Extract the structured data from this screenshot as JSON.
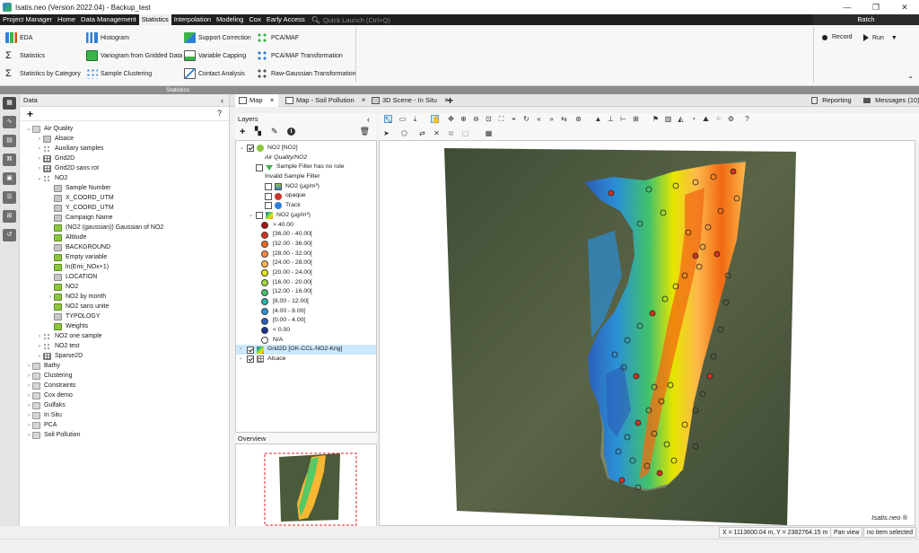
{
  "window": {
    "title": "Isatis.neo (Version 2022.04) - Backup_test",
    "controls": [
      "—",
      "❐",
      "✕"
    ]
  },
  "menu": {
    "items": [
      "Project Manager",
      "Home",
      "Data Management",
      "Statistics",
      "Interpolation",
      "Modeling",
      "Cox",
      "Early Access"
    ],
    "active": "Statistics",
    "quick_launch": "Quick Launch (Ctrl+Q)",
    "batch": "Batch"
  },
  "ribbon": {
    "col1": [
      "EDA",
      "Statistics",
      "Statistics by Category"
    ],
    "col2": [
      "Histogram",
      "Variogram from Gridded Data",
      "Sample Clustering"
    ],
    "col3": [
      "Support Correction",
      "Variable Capping",
      "Contact Analysis"
    ],
    "col4": [
      "PCA/MAF",
      "PCA/MAF Transformation",
      "Raw-Gaussian Transformation"
    ],
    "group_label": "Statistics",
    "batch_record": "Record",
    "batch_run": "Run"
  },
  "data_panel": {
    "title": "Data",
    "add": "+",
    "help": "?",
    "tree": [
      {
        "label": "Air Quality",
        "indent": 0,
        "icon": "folder",
        "caret": "⌄"
      },
      {
        "label": "Alsace",
        "indent": 1,
        "icon": "polygon",
        "caret": "›"
      },
      {
        "label": "Auxiliary samples",
        "indent": 1,
        "icon": "points",
        "caret": "›"
      },
      {
        "label": "Grid2D",
        "indent": 1,
        "icon": "grid",
        "caret": "›"
      },
      {
        "label": "Grid2D sans rot",
        "indent": 1,
        "icon": "grid",
        "caret": "›"
      },
      {
        "label": "NO2",
        "indent": 1,
        "icon": "points",
        "caret": "⌄"
      },
      {
        "label": "Sample Number",
        "indent": 2,
        "icon": "var",
        "caret": ""
      },
      {
        "label": "X_COORD_UTM",
        "indent": 2,
        "icon": "var",
        "caret": ""
      },
      {
        "label": "Y_COORD_UTM",
        "indent": 2,
        "icon": "var",
        "caret": ""
      },
      {
        "label": "Campaign Name",
        "indent": 2,
        "icon": "var",
        "caret": ""
      },
      {
        "label": "(NO2 (gaussian)) Gaussian of NO2",
        "indent": 2,
        "icon": "var-g",
        "caret": ""
      },
      {
        "label": "Altitude",
        "indent": 2,
        "icon": "var-g",
        "caret": ""
      },
      {
        "label": "BACKGROUND",
        "indent": 2,
        "icon": "var",
        "caret": ""
      },
      {
        "label": "Empty variable",
        "indent": 2,
        "icon": "var-g",
        "caret": ""
      },
      {
        "label": "ln(Emi_NOx+1)",
        "indent": 2,
        "icon": "var-g",
        "caret": ""
      },
      {
        "label": "LOCATION",
        "indent": 2,
        "icon": "var",
        "caret": ""
      },
      {
        "label": "NO2",
        "indent": 2,
        "icon": "var-g",
        "caret": ""
      },
      {
        "label": "NO2 by month",
        "indent": 2,
        "icon": "var-g",
        "caret": "›"
      },
      {
        "label": "NO2 sans unite",
        "indent": 2,
        "icon": "var-g",
        "caret": ""
      },
      {
        "label": "TYPOLOGY",
        "indent": 2,
        "icon": "var",
        "caret": ""
      },
      {
        "label": "Weights",
        "indent": 2,
        "icon": "var-g",
        "caret": ""
      },
      {
        "label": "NO2 one sample",
        "indent": 1,
        "icon": "points",
        "caret": "›"
      },
      {
        "label": "NO2 test",
        "indent": 1,
        "icon": "points",
        "caret": "›"
      },
      {
        "label": "Sparse2D",
        "indent": 1,
        "icon": "grid",
        "caret": "›"
      },
      {
        "label": "Bathy",
        "indent": 0,
        "icon": "folder",
        "caret": "›"
      },
      {
        "label": "Clustering",
        "indent": 0,
        "icon": "folder",
        "caret": "›"
      },
      {
        "label": "Constraints",
        "indent": 0,
        "icon": "folder",
        "caret": "›"
      },
      {
        "label": "Cox demo",
        "indent": 0,
        "icon": "folder",
        "caret": "›"
      },
      {
        "label": "Gulfaks",
        "indent": 0,
        "icon": "folder",
        "caret": "›"
      },
      {
        "label": "In Situ",
        "indent": 0,
        "icon": "folder",
        "caret": "›"
      },
      {
        "label": "PCA",
        "indent": 0,
        "icon": "folder",
        "caret": "›"
      },
      {
        "label": "Soil Pollution",
        "indent": 0,
        "icon": "folder",
        "caret": "›"
      }
    ]
  },
  "tabs": [
    {
      "label": "Map",
      "active": true
    },
    {
      "label": "Map - Soil Pollution",
      "active": false
    },
    {
      "label": "3D Scene - In Situ",
      "active": false
    }
  ],
  "right_tabs": {
    "reporting": "Reporting",
    "messages": "Messages (10)"
  },
  "layers": {
    "title": "Layers",
    "rows": [
      {
        "label": "NO2 [NO2]",
        "kind": "layer",
        "checked": true,
        "indent": 0,
        "icon": "#8ec63f"
      },
      {
        "label": "Air Quality/NO2",
        "kind": "italic",
        "indent": 2
      },
      {
        "label": "Sample Filter has no rule",
        "kind": "layer",
        "checked": false,
        "indent": 1,
        "icon": "filter"
      },
      {
        "label": "Invalid Sample Filter",
        "kind": "text",
        "indent": 2
      },
      {
        "label": "NO2 (µg/m³)",
        "kind": "layer",
        "checked": false,
        "indent": 2,
        "icon": "img"
      },
      {
        "label": "opaque",
        "kind": "layer",
        "checked": false,
        "indent": 2,
        "icon": "#c0392b"
      },
      {
        "label": "Track",
        "kind": "layer",
        "checked": false,
        "indent": 2,
        "icon": "#2f7fd8"
      },
      {
        "label": "NO2 (µg/m³)",
        "kind": "layer",
        "checked": false,
        "indent": 1,
        "icon": "grad",
        "caret": true
      },
      {
        "label": "> 40.00",
        "kind": "legend",
        "color": "#a50f15"
      },
      {
        "label": "[36.00 - 40.00[",
        "kind": "legend",
        "color": "#d7301f"
      },
      {
        "label": "[32.00 - 36.00[",
        "kind": "legend",
        "color": "#f16913"
      },
      {
        "label": "[28.00 - 32.00[",
        "kind": "legend",
        "color": "#fd8d3c"
      },
      {
        "label": "[24.00 - 28.00[",
        "kind": "legend",
        "color": "#fdb84a"
      },
      {
        "label": "[20.00 - 24.00[",
        "kind": "legend",
        "color": "#e6e600"
      },
      {
        "label": "[16.00 - 20.00[",
        "kind": "legend",
        "color": "#a1d936"
      },
      {
        "label": "[12.00 - 16.00[",
        "kind": "legend",
        "color": "#41c26a"
      },
      {
        "label": "[8.00 - 12.00[",
        "kind": "legend",
        "color": "#1fb5b0"
      },
      {
        "label": "[4.00 - 8.00[",
        "kind": "legend",
        "color": "#2b8fd6"
      },
      {
        "label": "[0.00 - 4.00[",
        "kind": "legend",
        "color": "#2c5bb8"
      },
      {
        "label": "< 0.00",
        "kind": "legend",
        "color": "#1e2f8f"
      },
      {
        "label": "N/A",
        "kind": "legend",
        "color": "#ffffff"
      },
      {
        "label": "Grid2D [OK-CCL-NO2-Krig]",
        "kind": "layer",
        "checked": true,
        "indent": 0,
        "icon": "grad",
        "selected": true
      },
      {
        "label": "Alsace",
        "kind": "layer",
        "checked": true,
        "indent": 0,
        "icon": "grid"
      }
    ],
    "overview": "Overview"
  },
  "map": {
    "logo": "Isatis.neo ®",
    "coords": "X = 1113600.04 m, Y = 2382764.15 m",
    "mode": "Pan view",
    "selection": "no item selected"
  },
  "colors": {
    "accent": "#2f7fd8",
    "menubar": "#1f1f1f",
    "selection": "#cce8ff"
  }
}
